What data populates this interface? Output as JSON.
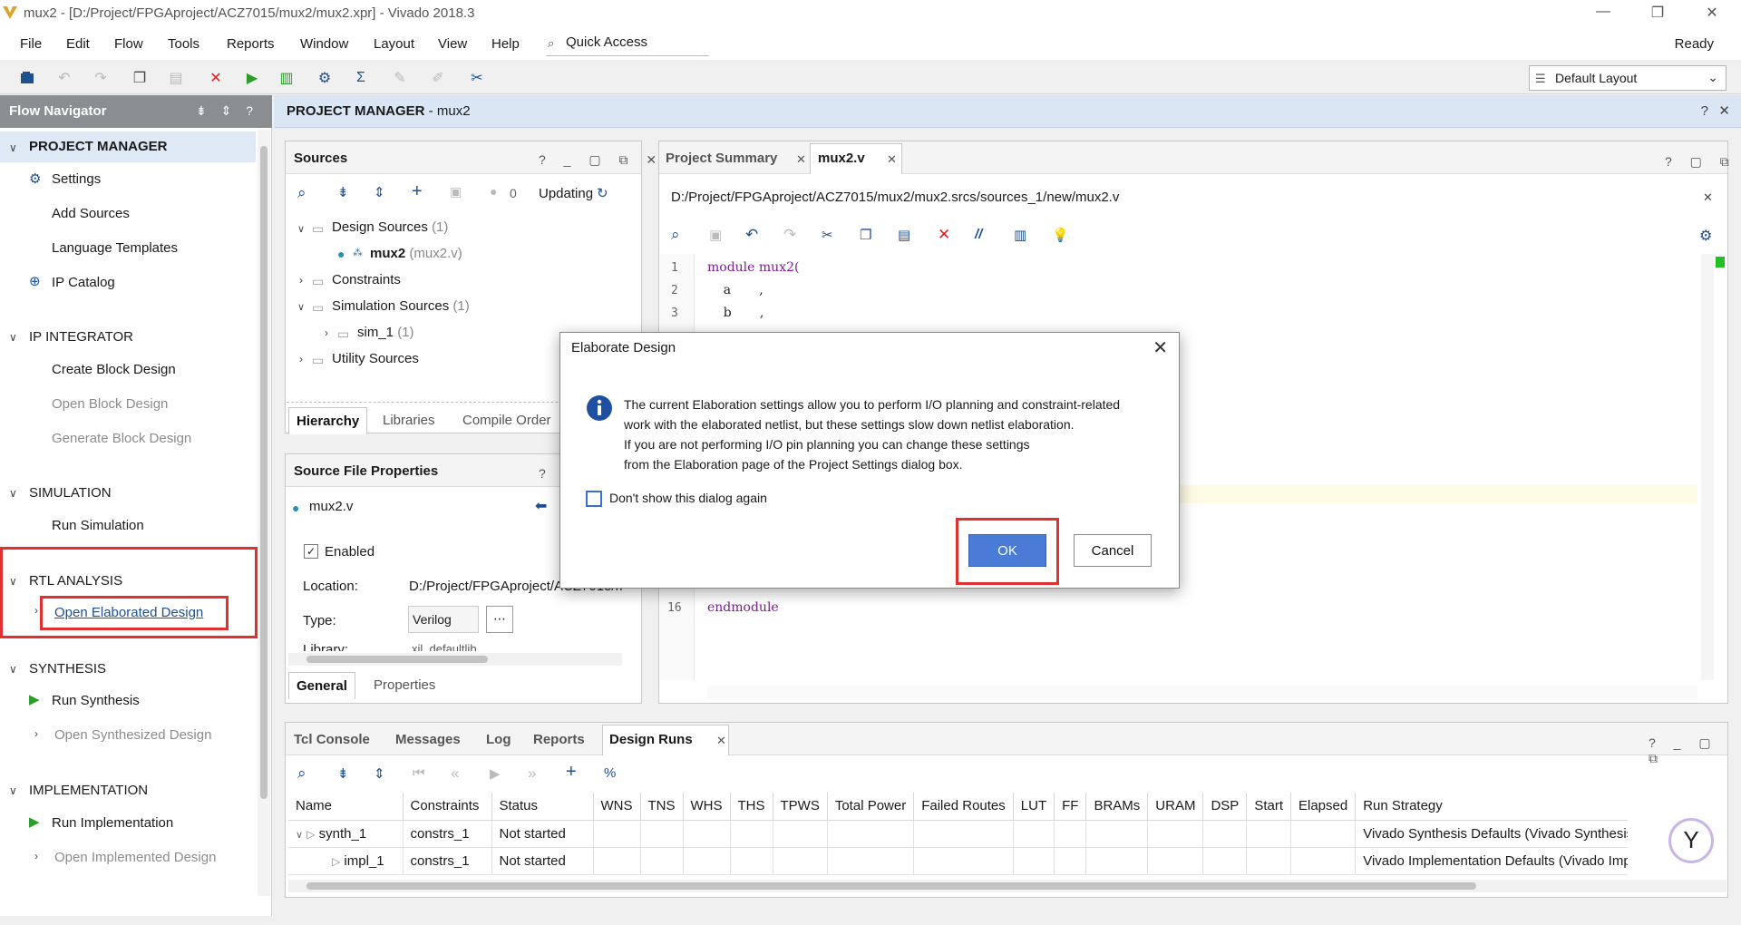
{
  "window": {
    "title": "mux2 - [D:/Project/FPGAproject/ACZ7015/mux2/mux2.xpr] - Vivado 2018.3",
    "minimize": "—",
    "maximize": "❐",
    "close": "✕"
  },
  "menu": [
    "File",
    "Edit",
    "Flow",
    "Tools",
    "Reports",
    "Window",
    "Layout",
    "View",
    "Help"
  ],
  "quick_access": "Quick Access",
  "status": "Ready",
  "layout_select": "Default Layout",
  "flow_navigator": {
    "title": "Flow Navigator",
    "header_icons": "⇟ ⇕ ? _",
    "sections": [
      {
        "label": "PROJECT MANAGER",
        "items": [
          "Settings",
          "Add Sources",
          "Language Templates",
          "IP Catalog"
        ]
      },
      {
        "label": "IP INTEGRATOR",
        "items": [
          "Create Block Design",
          "Open Block Design",
          "Generate Block Design"
        ]
      },
      {
        "label": "SIMULATION",
        "items": [
          "Run Simulation"
        ]
      },
      {
        "label": "RTL ANALYSIS",
        "items": [
          "Open Elaborated Design"
        ]
      },
      {
        "label": "SYNTHESIS",
        "items": [
          "Run Synthesis",
          "Open Synthesized Design"
        ]
      },
      {
        "label": "IMPLEMENTATION",
        "items": [
          "Run Implementation",
          "Open Implemented Design"
        ]
      }
    ]
  },
  "project_manager_header": {
    "title": "PROJECT MANAGER",
    "project": "mux2"
  },
  "sources": {
    "title": "Sources",
    "count": "0",
    "updating": "Updating",
    "tree": [
      {
        "label": "Design Sources",
        "count": "(1)"
      },
      {
        "label": "mux2",
        "sub": "(mux2.v)"
      },
      {
        "label": "Constraints",
        "count": ""
      },
      {
        "label": "Simulation Sources",
        "count": "(1)"
      },
      {
        "label": "sim_1",
        "count": "(1)"
      },
      {
        "label": "Utility Sources",
        "count": ""
      }
    ],
    "tabs": [
      "Hierarchy",
      "Libraries",
      "Compile Order"
    ]
  },
  "source_file_properties": {
    "title": "Source File Properties",
    "file": "mux2.v",
    "enabled_label": "Enabled",
    "location_label": "Location:",
    "location_value": "D:/Project/FPGAproject/ACZ7015/m",
    "type_label": "Type:",
    "type_value": "Verilog",
    "library_label": "Library:",
    "library_value": "xil_defaultlib",
    "tabs": [
      "General",
      "Properties"
    ]
  },
  "editor": {
    "tabs": [
      "Project Summary",
      "mux2.v"
    ],
    "path": "D:/Project/FPGAproject/ACZ7015/mux2/mux2.srcs/sources_1/new/mux2.v",
    "lines": [
      {
        "no": "1",
        "text": "module mux2("
      },
      {
        "no": "2",
        "text": "    a       ,"
      },
      {
        "no": "3",
        "text": "    b       ,"
      },
      {
        "no": "16",
        "text": "endmodule"
      }
    ]
  },
  "bottom_panel": {
    "tabs": [
      "Tcl Console",
      "Messages",
      "Log",
      "Reports",
      "Design Runs"
    ],
    "columns": [
      "Name",
      "Constraints",
      "Status",
      "WNS",
      "TNS",
      "WHS",
      "THS",
      "TPWS",
      "Total Power",
      "Failed Routes",
      "LUT",
      "FF",
      "BRAMs",
      "URAM",
      "DSP",
      "Start",
      "Elapsed",
      "Run Strategy"
    ],
    "rows": [
      {
        "name": "synth_1",
        "constraints": "constrs_1",
        "status": "Not started",
        "strategy": "Vivado Synthesis Defaults (Vivado Synthesis"
      },
      {
        "name": "impl_1",
        "constraints": "constrs_1",
        "status": "Not started",
        "strategy": "Vivado Implementation Defaults (Vivado Implementati"
      }
    ]
  },
  "dialog": {
    "title": "Elaborate Design",
    "message": [
      "The current Elaboration settings allow you to perform I/O planning and constraint-related",
      "work with the elaborated netlist, but these settings slow down netlist elaboration.",
      "If you are not performing I/O pin planning you can change these settings",
      "from the Elaboration page of the Project Settings dialog box."
    ],
    "checkbox": "Don't show this dialog again",
    "ok": "OK",
    "cancel": "Cancel"
  },
  "colors": {
    "accent": "#4a7bd6",
    "highlight_red": "#e03030",
    "nav_header": "#8a8d92",
    "pm_header": "#dbe6f5"
  }
}
